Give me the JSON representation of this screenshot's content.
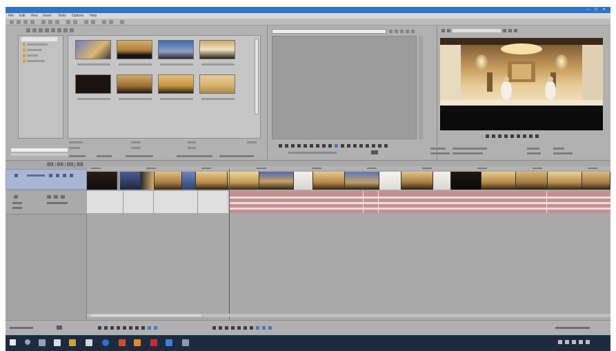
{
  "window": {
    "title": "",
    "controls": "— ▢ ✕"
  },
  "menu": {
    "items": [
      "File",
      "Edit",
      "View",
      "Insert",
      "Tools",
      "Options",
      "Help"
    ]
  },
  "timeline": {
    "counter": "00:00:00;00"
  },
  "colors": {
    "titlebar": "#2f74c6",
    "video_track": "#a8b6d4",
    "audio_clip": "#c78f8f",
    "taskbar": "#1e2a3e"
  },
  "icons": {
    "start": "windows-start-icon",
    "search": "search-icon",
    "taskview": "task-view-icon"
  }
}
